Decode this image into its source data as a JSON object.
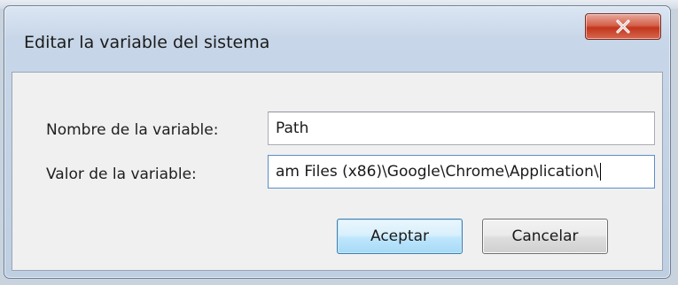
{
  "window": {
    "title": "Editar la variable del sistema"
  },
  "form": {
    "name_label": "Nombre de la variable:",
    "name_value": "Path",
    "value_label": "Valor de la variable:",
    "value_value": "am Files (x86)\\Google\\Chrome\\Application\\"
  },
  "buttons": {
    "accept_label": "Aceptar",
    "cancel_label": "Cancelar"
  },
  "icons": {
    "close": "close-icon"
  },
  "colors": {
    "close_button": "#c2361d",
    "focused_border": "#3c7fb1"
  }
}
